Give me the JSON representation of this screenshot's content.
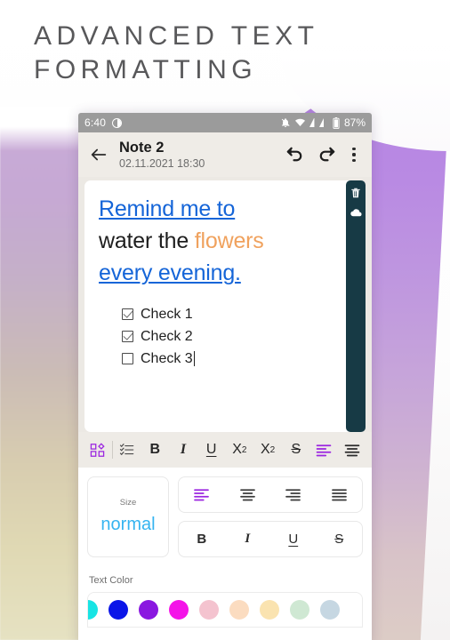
{
  "headline": {
    "line1": "ADVANCED TEXT",
    "line2": "FORMATTING"
  },
  "statusbar": {
    "time": "6:40",
    "dnd_icon": "do-not-disturb-icon",
    "mute_icon": "notifications-off-icon",
    "wifi_icon": "wifi-icon",
    "signal_icon": "signal-bars-icon",
    "battery_icon": "battery-icon",
    "battery_percent": "87%"
  },
  "appbar": {
    "back_icon": "arrow-back-icon",
    "title": "Note 2",
    "subtitle": "02.11.2021 18:30",
    "undo_icon": "undo-icon",
    "redo_icon": "redo-icon",
    "menu_icon": "overflow-menu-icon"
  },
  "note": {
    "line1": "Remind me to",
    "line2_black": "water the ",
    "line2_orange": "flowers",
    "line3": "every evening.",
    "checklist": [
      {
        "label": "Check 1",
        "checked": true
      },
      {
        "label": "Check 2",
        "checked": true
      },
      {
        "label": "Check 3",
        "checked": false
      }
    ],
    "colors": {
      "link_blue": "#1565d8",
      "body_black": "#1e1e1e",
      "accent_orange": "#f0a25e"
    }
  },
  "side_rail": {
    "delete_icon": "trash-icon",
    "cloud_icon": "cloud-sync-icon",
    "background": "#173a45"
  },
  "format_toolbar": {
    "items": [
      {
        "name": "shapes-grid-icon",
        "label": "",
        "active": true
      },
      {
        "name": "checklist-icon",
        "label": "",
        "active": false
      },
      {
        "name": "bold-button",
        "label": "B",
        "active": false
      },
      {
        "name": "italic-button",
        "label": "I",
        "active": false
      },
      {
        "name": "underline-button",
        "label": "U",
        "active": false
      },
      {
        "name": "subscript-button",
        "label": "X",
        "sup": "2",
        "active": false
      },
      {
        "name": "superscript-button",
        "label": "X",
        "sup": "2",
        "active": false
      },
      {
        "name": "strikethrough-button",
        "label": "S",
        "active": false
      },
      {
        "name": "align-left-button",
        "label": "",
        "active": true
      },
      {
        "name": "align-justify-button",
        "label": "",
        "active": false
      }
    ],
    "active_color": "#9b25e0"
  },
  "size_panel": {
    "label": "Size",
    "value": "normal",
    "value_color": "#35b4f0"
  },
  "alignment_panel": {
    "buttons": [
      {
        "name": "align-left-icon",
        "active": true
      },
      {
        "name": "align-center-icon",
        "active": false
      },
      {
        "name": "align-right-icon",
        "active": false
      },
      {
        "name": "align-justify-icon",
        "active": false
      }
    ]
  },
  "style_panel": {
    "buttons": [
      {
        "name": "bold-button",
        "label": "B"
      },
      {
        "name": "italic-button",
        "label": "I"
      },
      {
        "name": "underline-button",
        "label": "U"
      },
      {
        "name": "strikethrough-button",
        "label": "S"
      }
    ]
  },
  "text_color": {
    "label": "Text Color",
    "swatches": [
      "#18e4e4",
      "#0b15e8",
      "#8a17e0",
      "#f414e8",
      "#f4c3cf",
      "#fbdcc0",
      "#fae3b0",
      "#cfe8d3",
      "#c6d7e2"
    ]
  }
}
